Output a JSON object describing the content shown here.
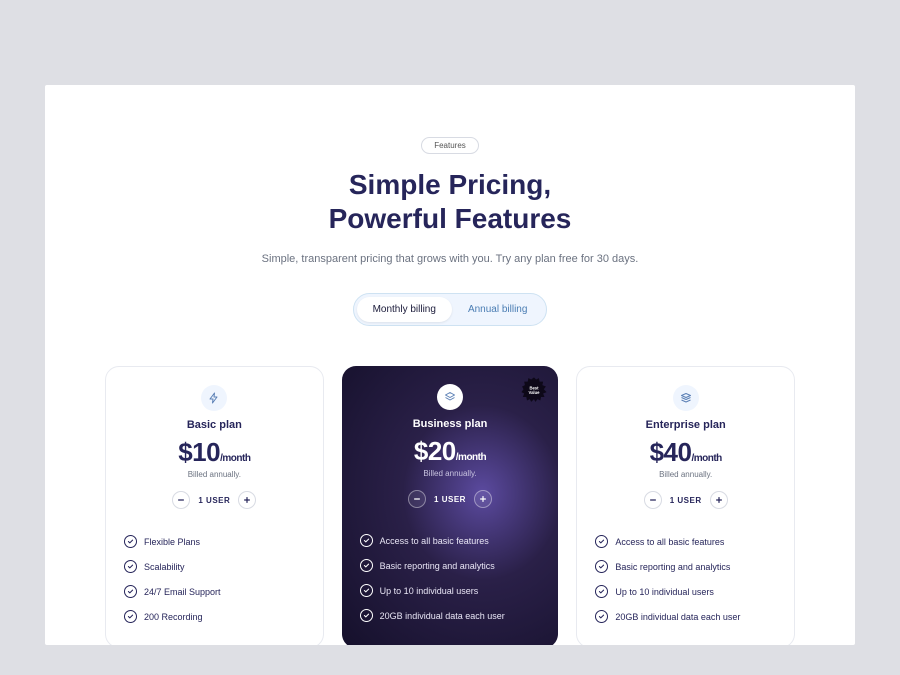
{
  "hero": {
    "badge": "Features",
    "title_line1": "Simple Pricing,",
    "title_line2": "Powerful Features",
    "subtitle": "Simple, transparent pricing that grows with you. Try any plan free for 30 days."
  },
  "toggle": {
    "monthly": "Monthly billing",
    "annual": "Annual billing",
    "active": "monthly"
  },
  "plans": [
    {
      "icon": "zap-icon",
      "name": "Basic plan",
      "price": "$10",
      "per": "/month",
      "billed": "Billed annually.",
      "user_label": "1 USER",
      "features": [
        "Flexible Plans",
        "Scalability",
        "24/7 Email Support",
        "200 Recording"
      ],
      "highlight": false
    },
    {
      "icon": "layers-icon",
      "name": "Business plan",
      "price": "$20",
      "per": "/month",
      "billed": "Billed annually.",
      "user_label": "1 USER",
      "badge": "Best Value",
      "features": [
        "Access to all basic features",
        "Basic reporting and analytics",
        "Up to 10 individual users",
        "20GB individual data each user"
      ],
      "highlight": true
    },
    {
      "icon": "stack-icon",
      "name": "Enterprise plan",
      "price": "$40",
      "per": "/month",
      "billed": "Billed annually.",
      "user_label": "1 USER",
      "features": [
        "Access to all basic features",
        "Basic reporting and analytics",
        "Up to 10 individual users",
        "20GB individual data each user"
      ],
      "highlight": false
    }
  ]
}
